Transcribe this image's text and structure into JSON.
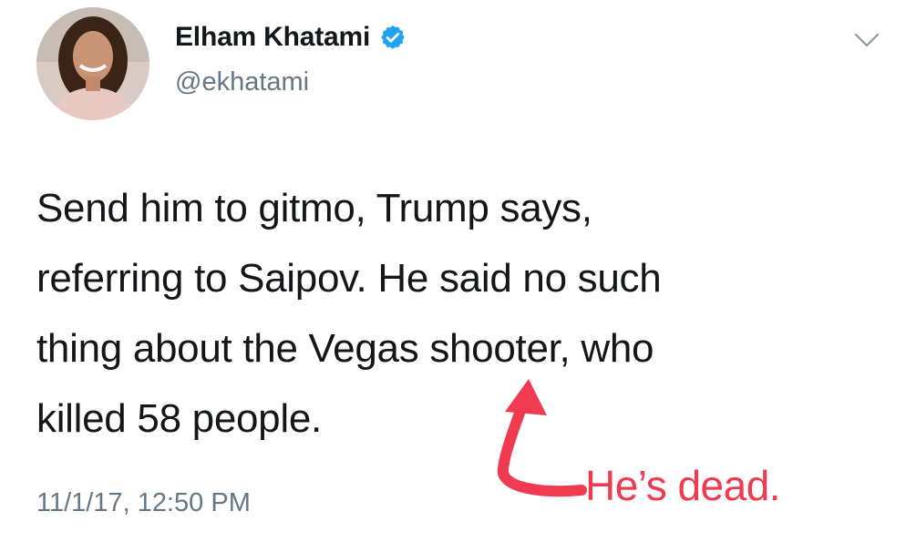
{
  "tweet": {
    "author": {
      "display_name": "Elham Khatami",
      "handle": "@ekhatami",
      "verified": true
    },
    "text_lines": [
      "Send him to gitmo, Trump says,",
      "referring to Saipov. He said no such",
      "thing about the Vegas shooter, who",
      "killed 58 people."
    ],
    "timestamp": "11/1/17, 12:50 PM"
  },
  "annotation": {
    "text": "He’s dead.",
    "color": "#f03a50"
  },
  "icons": {
    "verified": "verified-badge-icon",
    "menu": "chevron-down-icon",
    "arrow": "curved-arrow-icon"
  },
  "colors": {
    "verified_blue": "#1da1f2",
    "text_primary": "#14171a",
    "text_secondary": "#657786"
  }
}
